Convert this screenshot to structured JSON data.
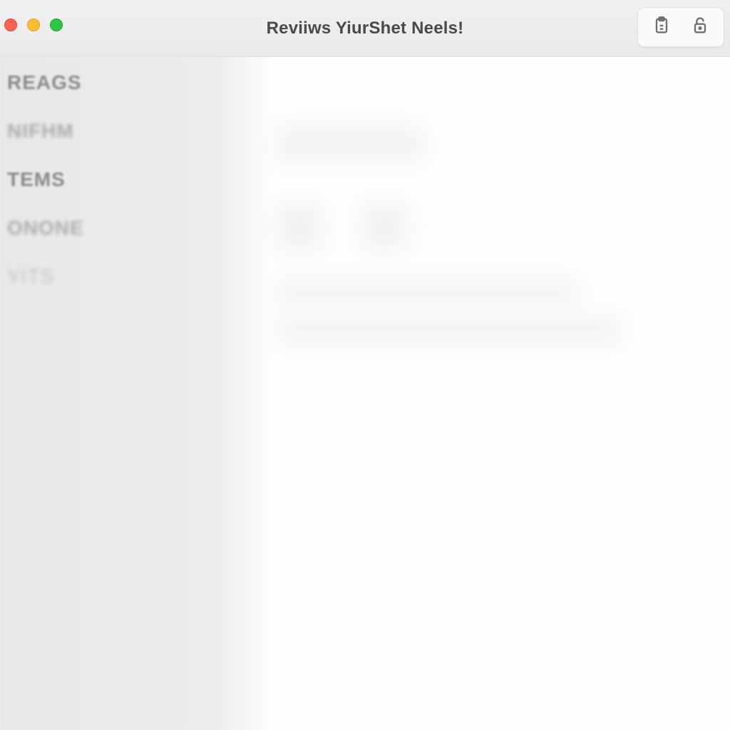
{
  "window": {
    "title": "Reviiws YiurShet Neels!"
  },
  "traffic_lights": {
    "close": "close",
    "minimize": "minimize",
    "maximize": "maximize"
  },
  "toolbar": {
    "clipboard_icon": "clipboard-icon",
    "lock_icon": "lock-icon"
  },
  "sidebar": {
    "items": [
      {
        "label": "REAGS"
      },
      {
        "label": "NIFHM"
      },
      {
        "label": "TEMS"
      },
      {
        "label": "ONONE"
      },
      {
        "label": "YITS"
      },
      {
        "label": ""
      },
      {
        "label": ""
      },
      {
        "label": ""
      },
      {
        "label": ""
      }
    ]
  }
}
